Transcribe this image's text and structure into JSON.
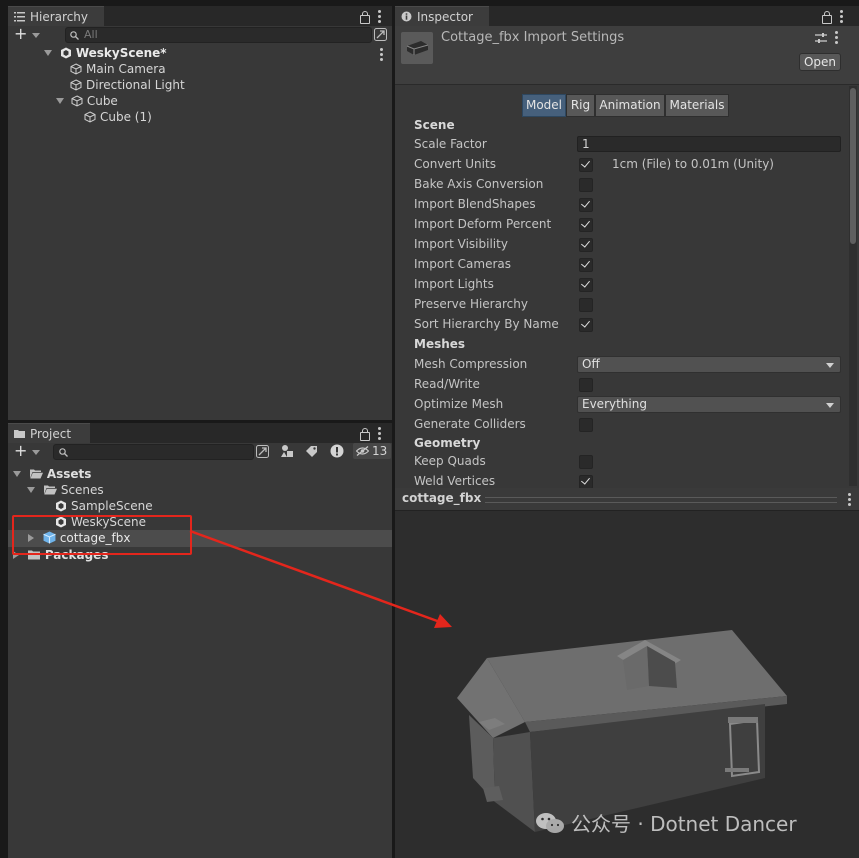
{
  "hierarchy": {
    "tab_label": "Hierarchy",
    "search_placeholder": "All",
    "add_symbol": "+",
    "items": [
      {
        "label": "WeskyScene*"
      },
      {
        "label": "Main Camera"
      },
      {
        "label": "Directional Light"
      },
      {
        "label": "Cube"
      },
      {
        "label": "Cube (1)"
      }
    ]
  },
  "project": {
    "tab_label": "Project",
    "add_symbol": "+",
    "hidden_count": "13",
    "items": [
      {
        "label": "Assets"
      },
      {
        "label": "Scenes"
      },
      {
        "label": "SampleScene"
      },
      {
        "label": "WeskyScene"
      },
      {
        "label": "cottage_fbx"
      },
      {
        "label": "Packages"
      }
    ]
  },
  "inspector": {
    "tab_label": "Inspector",
    "header_title": "Cottage_fbx Import Settings",
    "open_button": "Open",
    "tabs": [
      {
        "label": "Model",
        "active": true
      },
      {
        "label": "Rig",
        "active": false
      },
      {
        "label": "Animation",
        "active": false
      },
      {
        "label": "Materials",
        "active": false
      }
    ],
    "sections": {
      "scene": "Scene",
      "meshes": "Meshes",
      "geometry": "Geometry"
    },
    "scale_factor": {
      "label": "Scale Factor",
      "value": "1"
    },
    "convert_units": {
      "label": "Convert Units",
      "checked": true,
      "note": "1cm (File) to 0.01m (Unity)"
    },
    "checkboxes": [
      {
        "label": "Bake Axis Conversion",
        "checked": false
      },
      {
        "label": "Import BlendShapes",
        "checked": true
      },
      {
        "label": "Import Deform Percent",
        "checked": true
      },
      {
        "label": "Import Visibility",
        "checked": true
      },
      {
        "label": "Import Cameras",
        "checked": true
      },
      {
        "label": "Import Lights",
        "checked": true
      },
      {
        "label": "Preserve Hierarchy",
        "checked": false
      },
      {
        "label": "Sort Hierarchy By Name",
        "checked": true
      }
    ],
    "mesh_compression": {
      "label": "Mesh Compression",
      "value": "Off"
    },
    "read_write": {
      "label": "Read/Write",
      "checked": false
    },
    "optimize_mesh": {
      "label": "Optimize Mesh",
      "value": "Everything"
    },
    "generate_colliders": {
      "label": "Generate Colliders",
      "checked": false
    },
    "keep_quads": {
      "label": "Keep Quads",
      "checked": false
    },
    "weld_vertices": {
      "label": "Weld Vertices",
      "checked": true
    }
  },
  "preview": {
    "title": "cottage_fbx"
  },
  "watermark": {
    "text": "公众号 · Dotnet Dancer"
  },
  "colors": {
    "annotation_red": "#e4261c",
    "active_tab_blue": "#46607c",
    "panel_bg": "#383838"
  }
}
